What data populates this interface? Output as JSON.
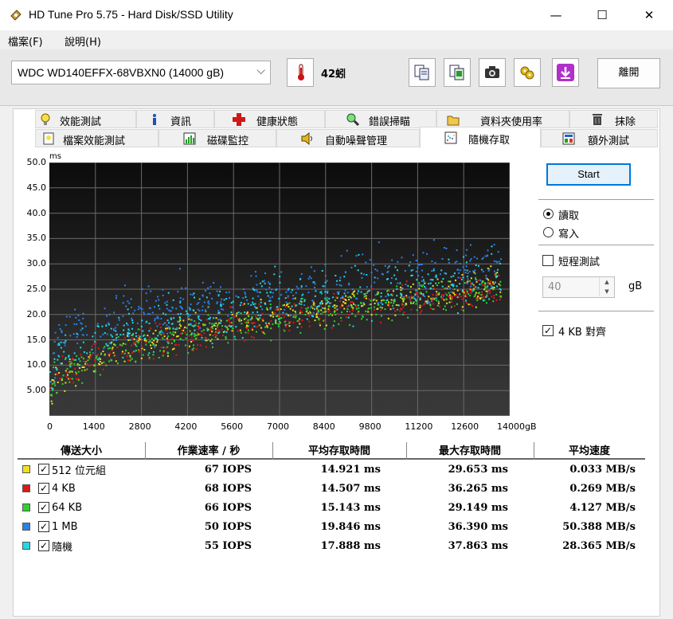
{
  "window": {
    "title": "HD Tune Pro 5.75 - Hard Disk/SSD Utility",
    "minimize": "—",
    "maximize": "☐",
    "close": "✕"
  },
  "menu": [
    {
      "label": "檔案(F)"
    },
    {
      "label": "說明(H)"
    }
  ],
  "toolbar": {
    "drive": "WDC WD140EFFX-68VBXN0 (14000 gB)",
    "temperature": "42蚓",
    "exit_label": "離開"
  },
  "tabs_row1": [
    {
      "label": "效能測試",
      "icon": "lightbulb-icon"
    },
    {
      "label": "資訊",
      "icon": "info-icon"
    },
    {
      "label": "健康狀態",
      "icon": "health-cross-icon"
    },
    {
      "label": "錯誤掃瞄",
      "icon": "magnifier-icon"
    },
    {
      "label": "資料夾使用率",
      "icon": "folder-icon"
    },
    {
      "label": "抹除",
      "icon": "trash-icon"
    }
  ],
  "tabs_row2": [
    {
      "label": "檔案效能測試",
      "icon": "file-bench-icon"
    },
    {
      "label": "磁碟監控",
      "icon": "monitor-icon"
    },
    {
      "label": "自動噪聲管理",
      "icon": "speaker-icon"
    },
    {
      "label": "隨機存取",
      "icon": "random-access-icon",
      "active": true
    },
    {
      "label": "額外測試",
      "icon": "extra-tests-icon"
    }
  ],
  "controls": {
    "start_label": "Start",
    "read_label": "讀取",
    "write_label": "寫入",
    "short_test_label": "短程測試",
    "short_test_value": "40",
    "unit_label": "gB",
    "align_label": "4 KB 對齊",
    "read_selected": true,
    "short_test_checked": false,
    "align_checked": true
  },
  "chart_data": {
    "type": "scatter",
    "ylabel": "ms",
    "xlabel_unit": "gB",
    "y_ticks": [
      "50.0",
      "45.0",
      "40.0",
      "35.0",
      "30.0",
      "25.0",
      "20.0",
      "15.0",
      "10.0",
      "5.00"
    ],
    "x_ticks": [
      "0",
      "1400",
      "2800",
      "4200",
      "5600",
      "7000",
      "8400",
      "9800",
      "11200",
      "12600",
      "14000gB"
    ],
    "xlim": [
      0,
      14000
    ],
    "ylim": [
      0,
      50
    ],
    "grid": true,
    "background": "#161616",
    "series": [
      {
        "name": "512 位元組",
        "color": "#f0e020",
        "y_start": 4.5,
        "y_end": 26.5,
        "spread": 5.5,
        "count": 380
      },
      {
        "name": "4 KB",
        "color": "#e01818",
        "y_start": 4.5,
        "y_end": 25.5,
        "spread": 5.5,
        "count": 380
      },
      {
        "name": "64 KB",
        "color": "#30d030",
        "y_start": 4.8,
        "y_end": 25.5,
        "spread": 6,
        "count": 380
      },
      {
        "name": "1 MB",
        "color": "#2a80e8",
        "y_start": 12,
        "y_end": 30,
        "spread": 9,
        "count": 420
      },
      {
        "name": "隨機",
        "color": "#20d8e8",
        "y_start": 9,
        "y_end": 28,
        "spread": 9,
        "count": 380
      }
    ]
  },
  "results": {
    "headers": [
      "傳送大小",
      "作業速率 / 秒",
      "平均存取時間",
      "最大存取時間",
      "平均速度"
    ],
    "rows": [
      {
        "size": "512 位元組",
        "color": "#f0e020",
        "iops": "67 IOPS",
        "avg": "14.921 ms",
        "max": "29.653 ms",
        "speed": "0.033 MB/s"
      },
      {
        "size": "4 KB",
        "color": "#e01818",
        "iops": "68 IOPS",
        "avg": "14.507 ms",
        "max": "36.265 ms",
        "speed": "0.269 MB/s"
      },
      {
        "size": "64 KB",
        "color": "#30d030",
        "iops": "66 IOPS",
        "avg": "15.143 ms",
        "max": "29.149 ms",
        "speed": "4.127 MB/s"
      },
      {
        "size": "1 MB",
        "color": "#2a80e8",
        "iops": "50 IOPS",
        "avg": "19.846 ms",
        "max": "36.390 ms",
        "speed": "50.388 MB/s"
      },
      {
        "size": "隨機",
        "color": "#20d8e8",
        "iops": "55 IOPS",
        "avg": "17.888 ms",
        "max": "37.863 ms",
        "speed": "28.365 MB/s"
      }
    ]
  }
}
